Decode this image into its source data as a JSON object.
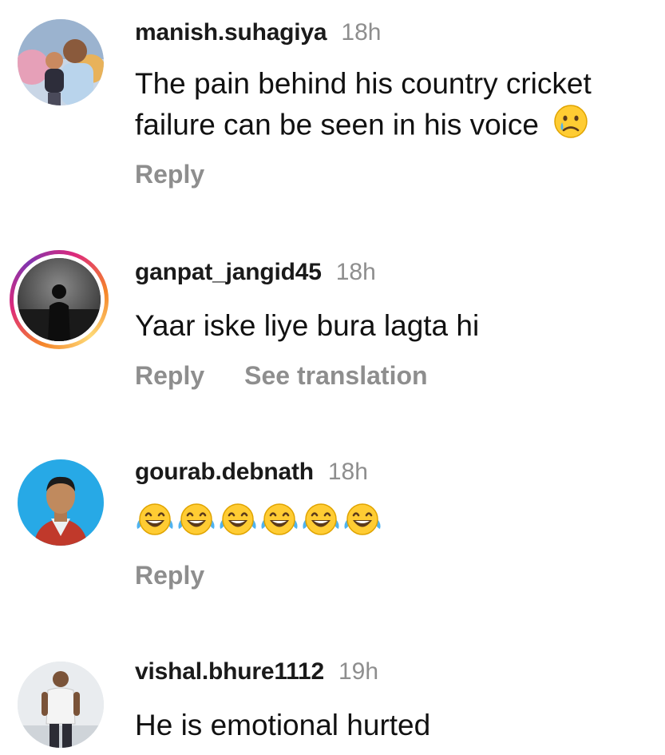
{
  "comments": [
    {
      "username": "manish.suhagiya",
      "time": "18h",
      "text": "The pain behind his country cricket failure can be seen in his voice",
      "emoji_icon": "crying-face-emoji",
      "actions": [
        "Reply"
      ]
    },
    {
      "username": "ganpat_jangid45",
      "time": "18h",
      "text": "Yaar iske liye bura lagta hi",
      "actions": [
        "Reply",
        "See translation"
      ]
    },
    {
      "username": "gourab.debnath",
      "time": "18h",
      "emoji_icon": "tears-of-joy-emoji",
      "emoji_count": 6,
      "actions": [
        "Reply"
      ]
    },
    {
      "username": "vishal.bhure1112",
      "time": "19h",
      "text": "He is emotional hurted"
    }
  ],
  "colors": {
    "text": "#111111",
    "meta": "#8e8e8e",
    "story_ring": [
      "#f58529",
      "#dd2a7b",
      "#8134af",
      "#feda77"
    ],
    "avatar_blue_bg": "#27a9e6"
  }
}
